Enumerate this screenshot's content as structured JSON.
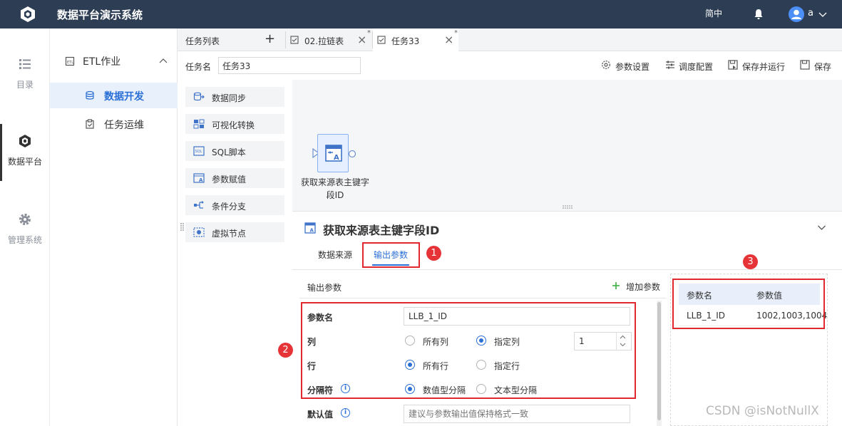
{
  "app": {
    "title": "数据平台演示系统",
    "lang": "简中",
    "user": "a"
  },
  "leftnav": [
    {
      "label": "目录",
      "icon": "list-icon"
    },
    {
      "label": "数据平台",
      "icon": "cubes-icon",
      "active": true
    },
    {
      "label": "管理系统",
      "icon": "gear-icon"
    }
  ],
  "subnav": {
    "group": "ETL作业",
    "items": [
      {
        "label": "数据开发",
        "active": true
      },
      {
        "label": "任务运维"
      }
    ]
  },
  "tabs": {
    "list_label": "任务列表",
    "add": "+",
    "items": [
      {
        "label": "02.拉链表",
        "modified": "*",
        "close": "×"
      },
      {
        "label": "任务33",
        "modified": "*",
        "close": "×",
        "active": true
      }
    ]
  },
  "task": {
    "name_label": "任务名",
    "name_value": "任务33",
    "tools": [
      "参数设置",
      "调度配置",
      "保存并运行",
      "保存"
    ]
  },
  "palette": [
    "数据同步",
    "可视化转换",
    "SQL脚本",
    "参数赋值",
    "条件分支",
    "虚拟节点"
  ],
  "node": {
    "label": "获取来源表主键字段ID"
  },
  "props": {
    "title": "获取来源表主键字段ID",
    "tabs": [
      "数据来源",
      "输出参数"
    ],
    "active_tab": "输出参数",
    "section_title": "输出参数",
    "add_param": "增加参数",
    "fields": {
      "param_name_label": "参数名",
      "param_name_value": "LLB_1_ID",
      "column_label": "列",
      "column_options": [
        "所有列",
        "指定列"
      ],
      "column_selected": "指定列",
      "column_value": "1",
      "row_label": "行",
      "row_options": [
        "所有行",
        "指定行"
      ],
      "row_selected": "所有行",
      "separator_label": "分隔符",
      "separator_options": [
        "数值型分隔",
        "文本型分隔"
      ],
      "separator_selected": "数值型分隔",
      "default_label": "默认值",
      "default_placeholder": "建议与参数输出值保持格式一致"
    },
    "result_table": {
      "headers": [
        "参数名",
        "参数值"
      ],
      "rows": [
        [
          "LLB_1_ID",
          "1002,1003,1004"
        ]
      ]
    }
  },
  "annotations": [
    "1",
    "2",
    "3"
  ],
  "watermark": "CSDN @isNotNullX",
  "colors": {
    "topbar": "#2d3e54",
    "accent": "#2a6fd6",
    "annotation": "#e0282e"
  }
}
